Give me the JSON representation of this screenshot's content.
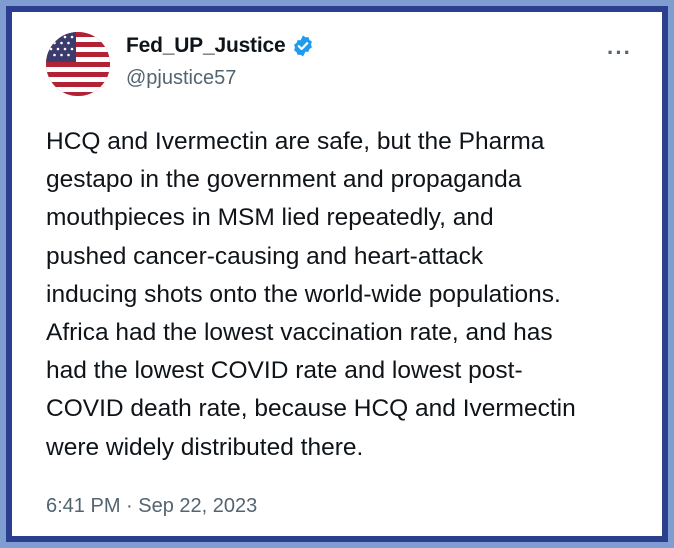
{
  "user": {
    "display_name": "Fed_UP_Justice",
    "handle": "@pjustice57",
    "verified": true,
    "avatar_icon": "american-flag-avatar"
  },
  "tweet": {
    "text": "HCQ and Ivermectin are safe, but the Pharma\ngestapo in the government and propaganda\nmouthpieces in MSM lied repeatedly, and\npushed cancer-causing and heart-attack\ninducing shots onto the world-wide populations.\nAfrica had the lowest vaccination rate, and has\nhad the lowest COVID rate and lowest post-\nCOVID death rate, because HCQ and Ivermectin\nwere widely distributed there.",
    "timestamp": "6:41 PM · Sep 22, 2023"
  },
  "more_menu_label": "···",
  "colors": {
    "frame_outer": "#7f9dd0",
    "frame_inner": "#2c3f8f",
    "verified_blue": "#1d9bf0",
    "text_primary": "#0f1419",
    "text_secondary": "#536471"
  }
}
